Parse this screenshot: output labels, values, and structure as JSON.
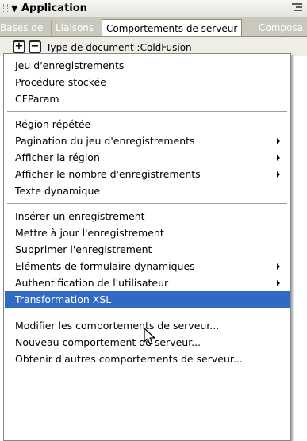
{
  "panel": {
    "title": "Application",
    "collapse_arrow": "▼",
    "options_icon": "panel-options-icon"
  },
  "tabs": [
    {
      "label": "Bases de",
      "active": false
    },
    {
      "label": "Liaisons",
      "active": false
    },
    {
      "label": "Comportements de serveur",
      "active": true
    },
    {
      "label": "Composa",
      "active": false
    }
  ],
  "toolbar": {
    "add_label": "+",
    "remove_label": "−",
    "doc_type": "Type de document :ColdFusion"
  },
  "menu": {
    "highlight_color": "#316ac5",
    "groups": [
      {
        "items": [
          {
            "label": "Jeu d'enregistrements",
            "submenu": false
          },
          {
            "label": "Procédure stockée",
            "submenu": false
          },
          {
            "label": "CFParam",
            "submenu": false
          }
        ]
      },
      {
        "items": [
          {
            "label": "Région répétée",
            "submenu": false
          },
          {
            "label": "Pagination du jeu d'enregistrements",
            "submenu": true
          },
          {
            "label": "Afficher la région",
            "submenu": true
          },
          {
            "label": "Afficher le nombre d'enregistrements",
            "submenu": true
          },
          {
            "label": "Texte dynamique",
            "submenu": false
          }
        ]
      },
      {
        "items": [
          {
            "label": "Insérer un enregistrement",
            "submenu": false
          },
          {
            "label": "Mettre à jour l'enregistrement",
            "submenu": false
          },
          {
            "label": "Supprimer l'enregistrement",
            "submenu": false
          },
          {
            "label": "Eléments de formulaire dynamiques",
            "submenu": true
          },
          {
            "label": "Authentification de l'utilisateur",
            "submenu": true
          },
          {
            "label": "Transformation XSL",
            "submenu": false,
            "highlighted": true
          }
        ]
      },
      {
        "items": [
          {
            "label": "Modifier les comportements de serveur...",
            "submenu": false
          },
          {
            "label": "Nouveau comportement de serveur...",
            "submenu": false
          },
          {
            "label": "Obtenir d'autres comportements de serveur...",
            "submenu": false
          }
        ]
      }
    ]
  }
}
